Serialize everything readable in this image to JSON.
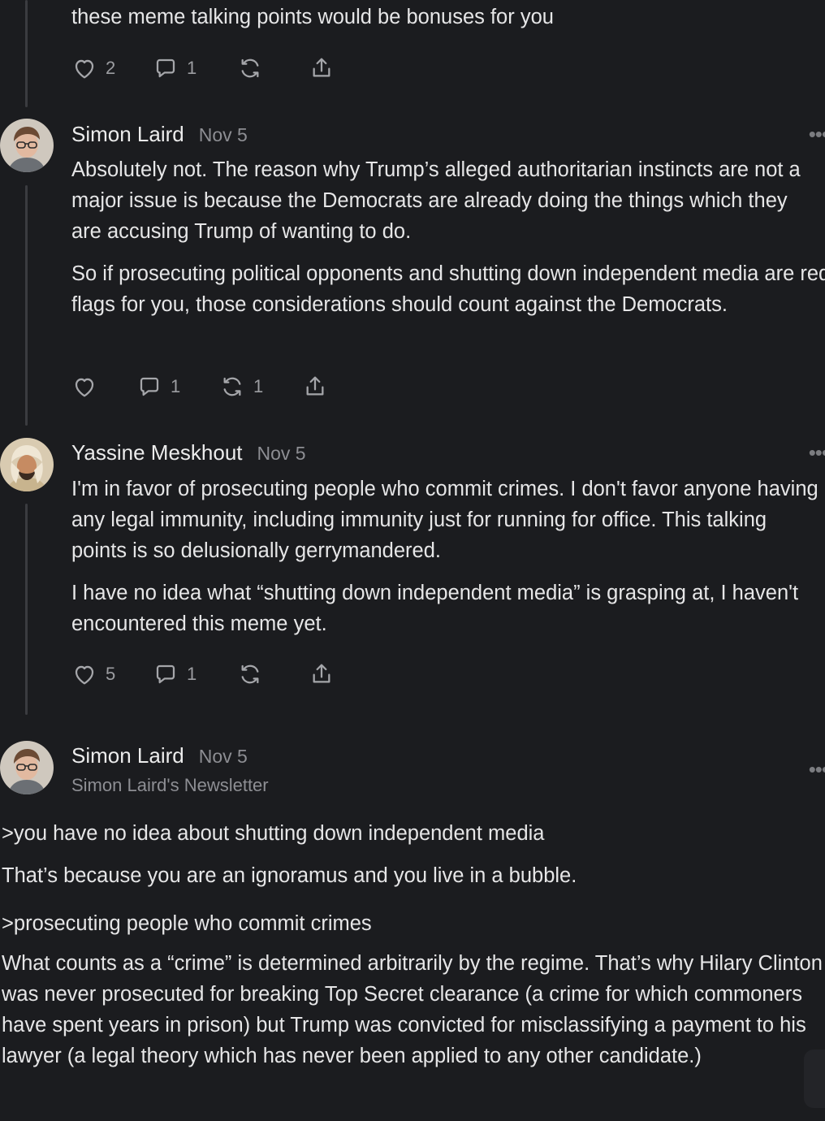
{
  "comment0": {
    "text": "these meme talking points would be bonuses for you",
    "likes": "2",
    "replies": "1",
    "restacks": ""
  },
  "comment1": {
    "author": "Simon Laird",
    "date": "Nov 5",
    "paragraphs": [
      "Absolutely not. The reason why Trump’s alleged authoritarian instincts are not a major issue is because the Democrats are already doing the things which they are accusing Trump of wanting to do.",
      "So if prosecuting political opponents and shutting down independent media are red flags for you, those considerations should count against the Democrats."
    ],
    "likes": "",
    "replies": "1",
    "restacks": "1"
  },
  "comment2": {
    "author": "Yassine Meskhout",
    "date": "Nov 5",
    "paragraphs": [
      "I'm in favor of prosecuting people who commit crimes. I don't favor anyone having any legal immunity, including immunity just for running for office. This talking points is so delusionally gerrymandered.",
      "I have no idea what “shutting down independent media” is grasping at, I haven't encountered this meme yet."
    ],
    "likes": "5",
    "replies": "1",
    "restacks": ""
  },
  "comment3": {
    "author": "Simon Laird",
    "date": "Nov 5",
    "newsletter": "Simon Laird's Newsletter",
    "paragraphs": [
      ">you have no idea about shutting down independent media",
      "That’s because you are an ignoramus and you live in a bubble.",
      ">prosecuting people who commit crimes",
      "What counts as a “crime” is determined arbitrarily by the regime. That’s why Hilary Clinton was never prosecuted for breaking Top Secret clearance (a crime for which commoners have spent years in prison) but Trump was convicted for misclassifying a payment to his lawyer (a legal theory which has never been applied to any other candidate.)"
    ]
  },
  "icons": [
    "heart-icon",
    "comment-icon",
    "restack-icon",
    "share-icon",
    "more-icon"
  ],
  "colors": {
    "background": "#1b1c1f",
    "text": "#e9e9ea",
    "muted": "#8d8e93",
    "thread_line": "#3b3c40"
  }
}
